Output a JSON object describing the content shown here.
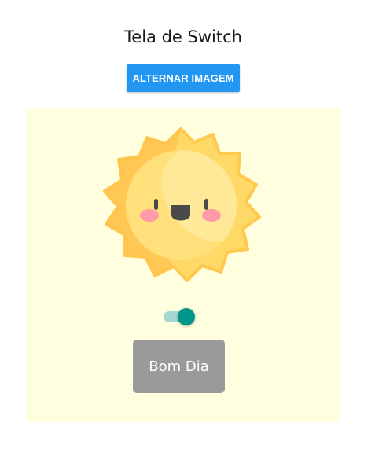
{
  "header": {
    "title": "Tela de Switch",
    "toggle_button_label": "ALTERNAR IMAGEM"
  },
  "panel": {
    "background_color": "#ffffe0",
    "image": "smiling-sun",
    "switch": {
      "state": "on",
      "track_color": "#a7d7d3",
      "thumb_color": "#009688"
    },
    "greeting_button_label": "Bom Dia"
  },
  "colors": {
    "accent": "#2196f3",
    "greeting_button": "#9a9a9a"
  }
}
